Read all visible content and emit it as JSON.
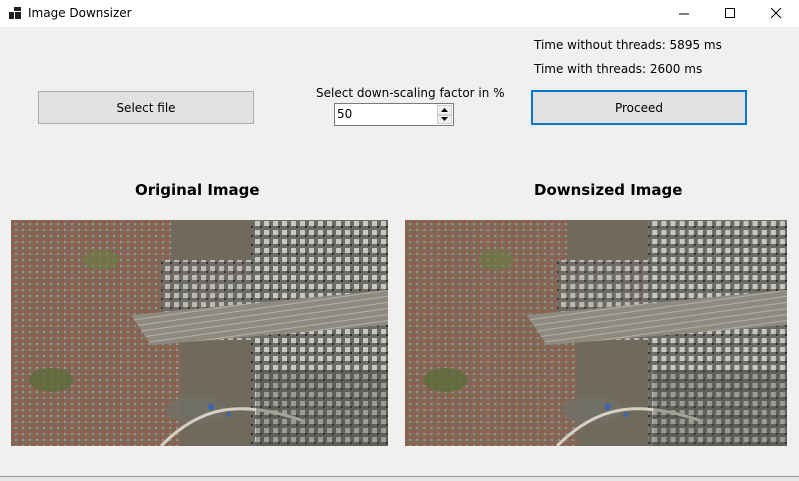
{
  "window": {
    "title": "Image Downsizer",
    "icons": [
      "app-icon",
      "minimize-icon",
      "maximize-icon",
      "close-icon"
    ]
  },
  "controls": {
    "select_file_label": "Select file",
    "factor_label": "Select down-scaling factor in %",
    "factor_value": "50",
    "proceed_label": "Proceed"
  },
  "timings": {
    "without_threads": "Time without threads: 5895 ms",
    "with_threads": "Time with threads: 2600 ms"
  },
  "panels": {
    "original_title": "Original Image",
    "downsized_title": "Downsized Image"
  },
  "colors": {
    "focus_border": "#0078d7",
    "button_face": "#e1e1e1",
    "window_background": "#f0f0f0"
  }
}
